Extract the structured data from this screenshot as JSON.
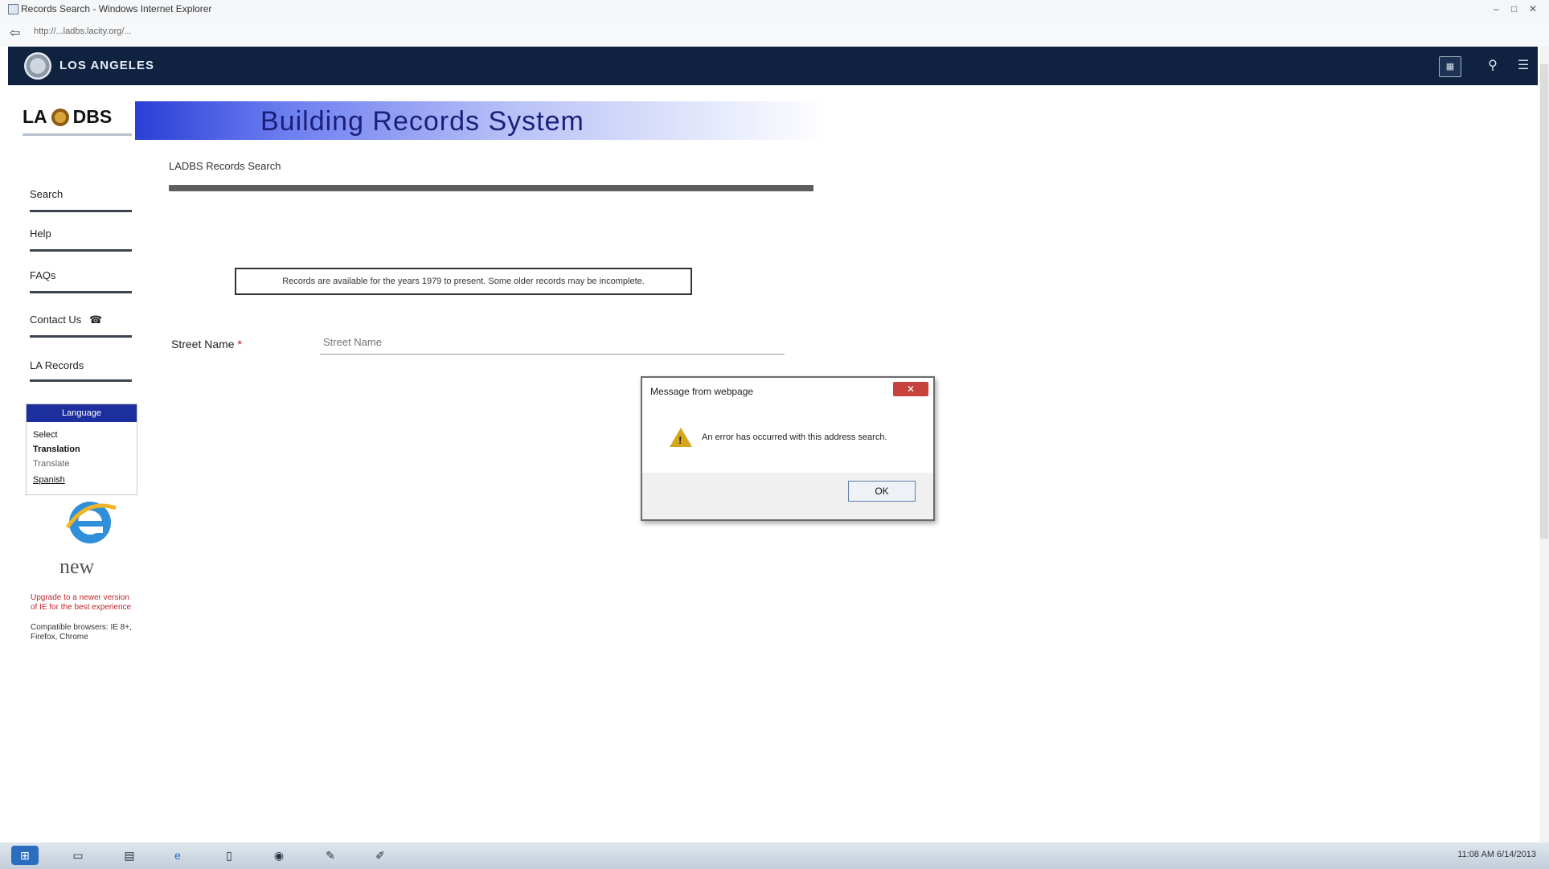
{
  "window": {
    "title": "Records Search - Windows Internet Explorer",
    "url": "http://...ladbs.lacity.org/..."
  },
  "city_header": {
    "name": "LOS ANGELES"
  },
  "logo": {
    "left": "LA",
    "right": "DBS"
  },
  "banner": {
    "title": "Building Records System"
  },
  "breadcrumb": "LADBS Records Search",
  "nav": {
    "items": [
      "Search",
      "Help",
      "FAQs",
      "Contact Us",
      "LA Records"
    ]
  },
  "languages": {
    "header": "Language",
    "items": [
      "Select",
      "Translation",
      "Translate",
      "Spanish"
    ]
  },
  "ie_promo": {
    "word": "new",
    "red_text": "Upgrade to a newer version of IE for the best experience",
    "grey_text": "Compatible browsers: IE 8+, Firefox, Chrome"
  },
  "notice": "Records are available for the years 1979 to present. Some older records may be incomplete.",
  "field": {
    "label": "Street Name",
    "value": "",
    "placeholder": "Street Name"
  },
  "dialog": {
    "title": "Message from webpage",
    "close": "✕",
    "message": "An error has occurred with this address search.",
    "ok": "OK"
  },
  "taskbar": {
    "clock": "11:08 AM  6/14/2013"
  }
}
